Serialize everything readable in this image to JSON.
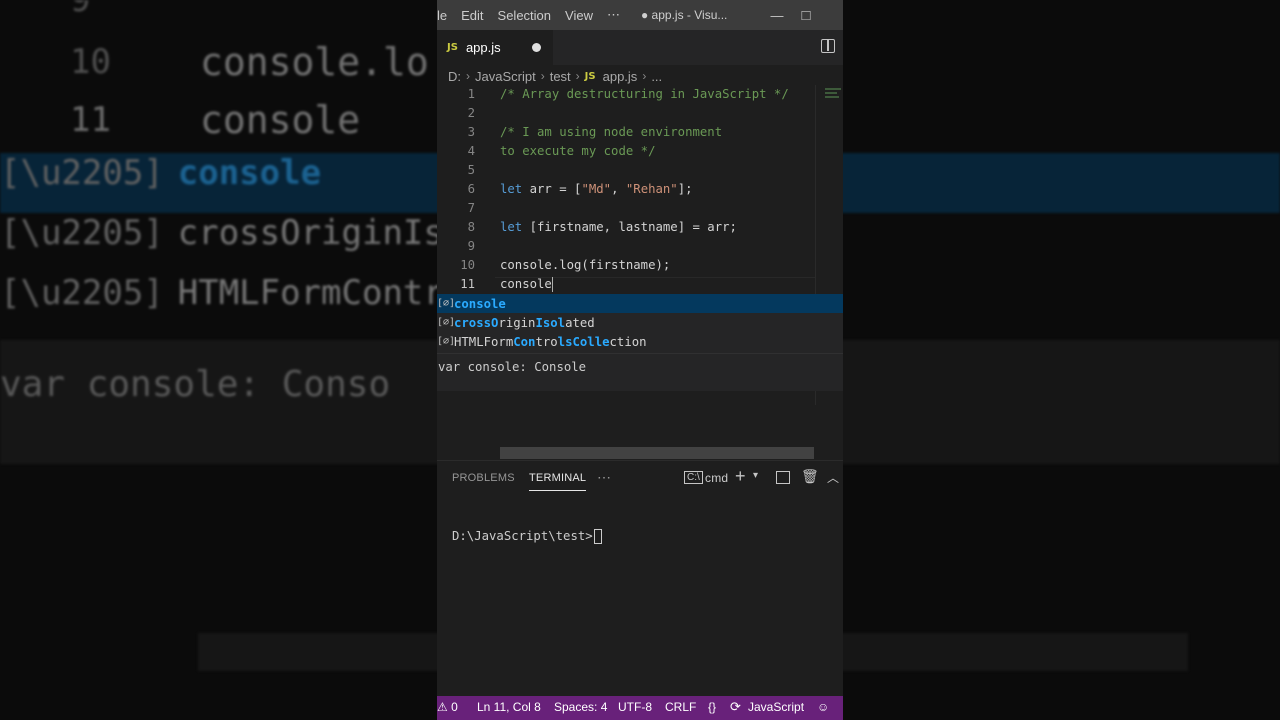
{
  "background": {
    "line10_num": "10",
    "line10_code": "console.lo",
    "line11_num": "11",
    "line11_code": "console",
    "suggestions": [
      "console",
      "crossOriginIsola",
      "HTMLFormControlsC"
    ],
    "hover": "var console: Conso"
  },
  "titlebar": {
    "menu": [
      "le",
      "Edit",
      "Selection",
      "View",
      "⋯"
    ],
    "title": "● app.js - Visu...",
    "minimize": "—",
    "maximize": "□"
  },
  "tab": {
    "badge": "JS",
    "label": "app.js"
  },
  "breadcrumbs": [
    "D:",
    "JavaScript",
    "test",
    "app.js",
    "..."
  ],
  "breadcrumb_badge": "JS",
  "editor": {
    "line_numbers": [
      "1",
      "2",
      "3",
      "4",
      "5",
      "6",
      "7",
      "8",
      "9",
      "10",
      "11"
    ],
    "line1": "/* Array destructuring in JavaScript */",
    "line3": "/* I am using node environment",
    "line4": "to execute my code */",
    "line6_kw": "let",
    "line6_a": " arr = [",
    "line6_s1": "\"Md\"",
    "line6_b": ", ",
    "line6_s2": "\"Rehan\"",
    "line6_c": "];",
    "line8_kw": "let",
    "line8_rest": " [firstname, lastname] = arr;",
    "line10": "console.log(firstname);",
    "line11": "console"
  },
  "suggest": {
    "icon": "[∅]",
    "item1": "console",
    "item2_parts": [
      "cross",
      "O",
      "rigin",
      "I",
      "s",
      "ol",
      "a",
      "ted"
    ],
    "item3_parts": [
      "HTMLForm",
      "Con",
      "tro",
      "ls",
      "Col",
      "le",
      "ction"
    ],
    "details": "var console: Console"
  },
  "panel": {
    "problems": "PROBLEMS",
    "terminal": "TERMINAL",
    "more": "⋯",
    "shell": "cmd",
    "prompt": "D:\\JavaScript\\test>"
  },
  "statusbar": {
    "errors": "⚠ 0",
    "position": "Ln 11, Col 8",
    "spaces": "Spaces: 4",
    "encoding": "UTF-8",
    "eol": "CRLF",
    "braces": "{}",
    "language": "JavaScript"
  }
}
